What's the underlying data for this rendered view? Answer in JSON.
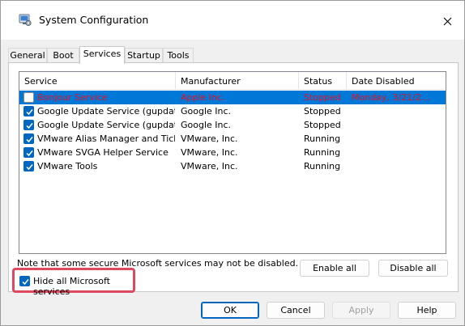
{
  "window": {
    "title": "System Configuration"
  },
  "tabs": [
    {
      "label": "General"
    },
    {
      "label": "Boot"
    },
    {
      "label": "Services"
    },
    {
      "label": "Startup"
    },
    {
      "label": "Tools"
    }
  ],
  "services": {
    "columns": [
      "Service",
      "Manufacturer",
      "Status",
      "Date Disabled"
    ],
    "rows": [
      {
        "service": "Bonjour Service",
        "manufacturer": "Apple Inc.",
        "status": "Stopped",
        "date_disabled": "Monday, 3/21/2...",
        "checked": false,
        "selected": true
      },
      {
        "service": "Google Update Service (gupdate)",
        "manufacturer": "Google Inc.",
        "status": "Stopped",
        "date_disabled": "",
        "checked": true,
        "selected": false
      },
      {
        "service": "Google Update Service (gupdatem)",
        "manufacturer": "Google Inc.",
        "status": "Stopped",
        "date_disabled": "",
        "checked": true,
        "selected": false
      },
      {
        "service": "VMware Alias Manager and Ticke...",
        "manufacturer": "VMware, Inc.",
        "status": "Running",
        "date_disabled": "",
        "checked": true,
        "selected": false
      },
      {
        "service": "VMware SVGA Helper Service",
        "manufacturer": "VMware, Inc.",
        "status": "Running",
        "date_disabled": "",
        "checked": true,
        "selected": false
      },
      {
        "service": "VMware Tools",
        "manufacturer": "VMware, Inc.",
        "status": "Running",
        "date_disabled": "",
        "checked": true,
        "selected": false
      }
    ]
  },
  "note": "Note that some secure Microsoft services may not be disabled.",
  "buttons": {
    "enable_all": "Enable all",
    "disable_all": "Disable all",
    "ok": "OK",
    "cancel": "Cancel",
    "apply": "Apply",
    "help": "Help"
  },
  "hide_ms": {
    "label": "Hide all Microsoft services",
    "checked": true
  },
  "colors": {
    "selection": "#0078d7",
    "highlight_border": "#e0485f",
    "check_blue": "#0067c0",
    "disabled_text": "#e81123"
  }
}
